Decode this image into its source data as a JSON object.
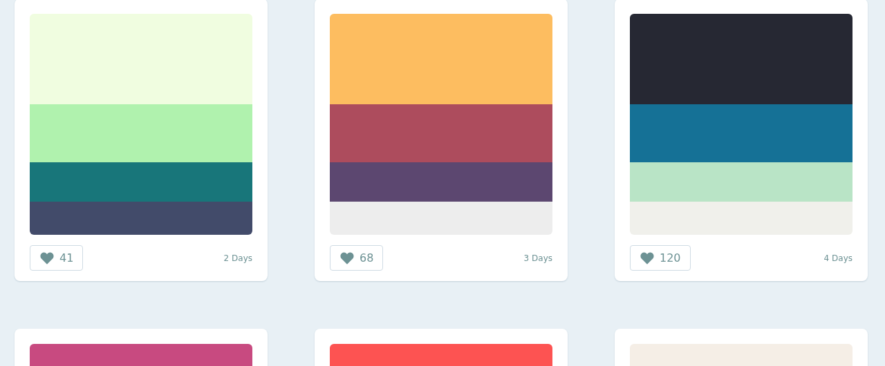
{
  "palettes": [
    {
      "stripes": [
        {
          "color": "#f0fde0"
        },
        {
          "color": "#b0f2ae"
        },
        {
          "color": "#18767a"
        },
        {
          "color": "#424b6a"
        }
      ],
      "likes": "41",
      "age": "2 Days"
    },
    {
      "stripes": [
        {
          "color": "#fdbd60"
        },
        {
          "color": "#ad4c5d"
        },
        {
          "color": "#5c4770"
        },
        {
          "color": "#ededed"
        }
      ],
      "likes": "68",
      "age": "3 Days"
    },
    {
      "stripes": [
        {
          "color": "#262833"
        },
        {
          "color": "#157196"
        },
        {
          "color": "#b9e4c6"
        },
        {
          "color": "#f0f0eb"
        }
      ],
      "likes": "120",
      "age": "4 Days"
    },
    {
      "stripes": [
        {
          "color": "#c84a80"
        }
      ]
    },
    {
      "stripes": [
        {
          "color": "#fd5352"
        }
      ]
    },
    {
      "stripes": [
        {
          "color": "#f5eee6"
        }
      ]
    }
  ]
}
